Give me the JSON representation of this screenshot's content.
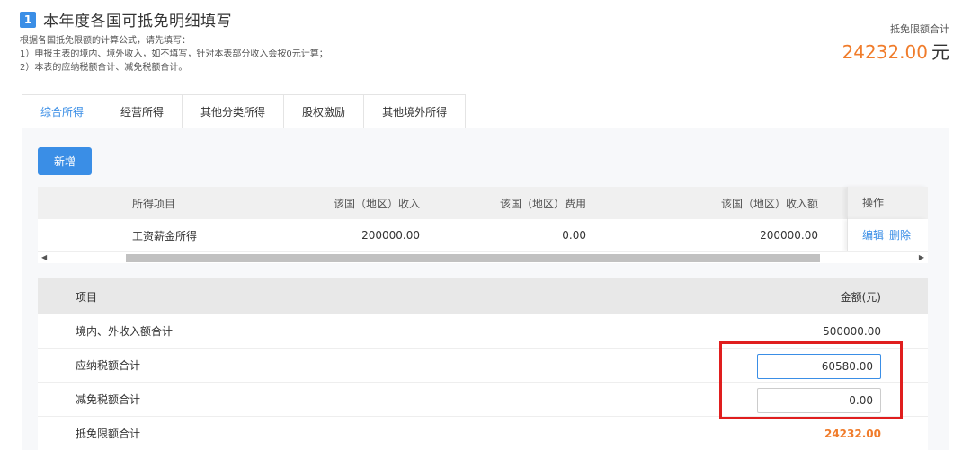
{
  "header": {
    "step": "1",
    "title": "本年度各国可抵免明细填写",
    "desc_lines": [
      "根据各国抵免限额的计算公式，请先填写：",
      "1）申报主表的境内、境外收入，如不填写，针对本表部分收入会按0元计算；",
      "2）本表的应纳税额合计、减免税额合计。"
    ],
    "total_label": "抵免限额合计",
    "total_value": "24232.00",
    "total_unit": "元"
  },
  "tabs": [
    "综合所得",
    "经营所得",
    "其他分类所得",
    "股权激励",
    "其他境外所得"
  ],
  "active_tab": 0,
  "add_button": "新增",
  "income_table": {
    "headers": {
      "item": "所得项目",
      "income": "该国（地区）收入",
      "fee": "该国（地区）费用",
      "amount": "该国（地区）收入额",
      "op": "操作"
    },
    "rows": [
      {
        "item": "工资薪金所得",
        "income": "200000.00",
        "fee": "0.00",
        "amount": "200000.00",
        "edit": "编辑",
        "delete": "删除"
      }
    ]
  },
  "summary_table": {
    "headers": {
      "item": "项目",
      "amount": "金额(元)"
    },
    "rows": {
      "total_income": {
        "label": "境内、外收入额合计",
        "value": "500000.00"
      },
      "tax_payable": {
        "label": "应纳税额合计",
        "value": "60580.00"
      },
      "tax_relief": {
        "label": "减免税额合计",
        "value": "0.00"
      },
      "credit_limit": {
        "label": "抵免限额合计",
        "value": "24232.00"
      }
    }
  },
  "colors": {
    "accent": "#3a8ee6",
    "orange": "#f07c2b",
    "highlight": "#e01e1e"
  }
}
